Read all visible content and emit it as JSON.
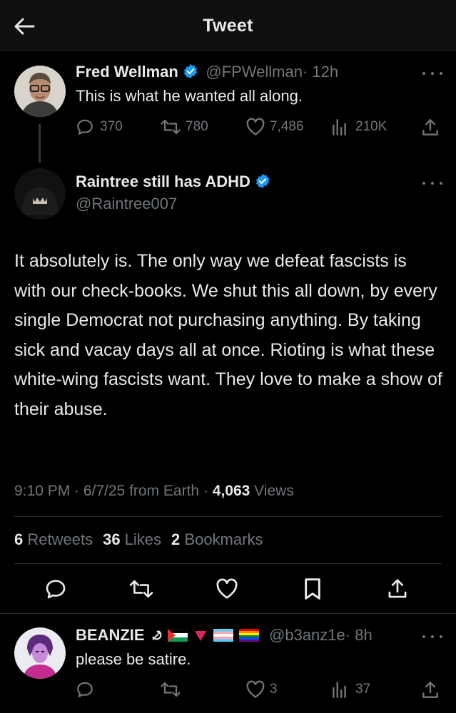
{
  "header": {
    "title": "Tweet"
  },
  "tweet1": {
    "name": "Fred Wellman",
    "handle": "@FPWellman",
    "time": "· 12h",
    "text": "This is what he wanted all along.",
    "replies": "370",
    "retweets": "780",
    "likes": "7,486",
    "views": "210K"
  },
  "tweet2": {
    "name": "Raintree still has ADHD",
    "handle": "@Raintree007",
    "text": "It absolutely is.   The only way we defeat fascists is with our check-books.  We shut this all down, by every single Democrat not purchasing anything. By taking sick and vacay days all at once. Rioting is what these white-wing fascists want. They love to make a show of their abuse.",
    "time": "9:10 PM · 6/7/25 from Earth · ",
    "views_count": "4,063",
    "views_label": " Views",
    "retweets_count": "6",
    "retweets_label": " Retweets",
    "likes_count": "36",
    "likes_label": " Likes",
    "bookmarks_count": "2",
    "bookmarks_label": " Bookmarks"
  },
  "tweet3": {
    "name": "BEANZIE",
    "handle": "@b3anz1e",
    "time": "· 8h",
    "text": "please be satire.",
    "likes": "3",
    "views": "37"
  },
  "colors": {
    "background": "#000000",
    "text": "#e7e9ea",
    "muted": "#71767b",
    "verified": "#1d9bf0",
    "divider": "#2f3336"
  }
}
